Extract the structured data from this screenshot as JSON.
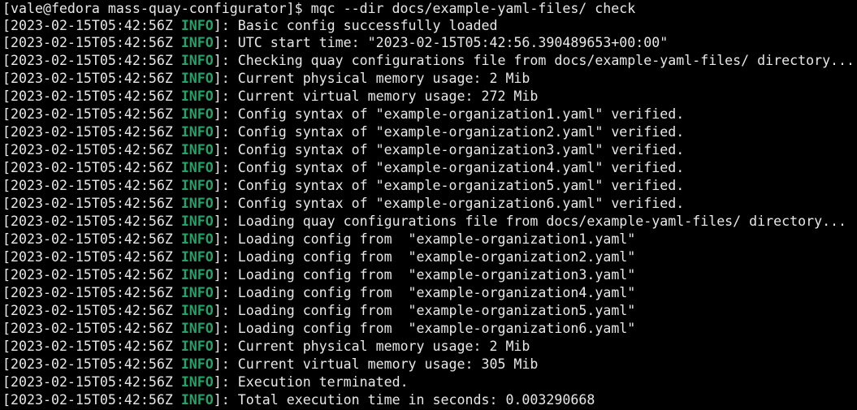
{
  "terminal": {
    "prompt_line": "[vale@fedora mass-quay-configurator]$ mqc --dir docs/example-yaml-files/ check",
    "colors": {
      "background": "#000000",
      "foreground": "#e8e8e8",
      "info_level": "#26a269"
    },
    "log_lines": [
      {
        "timestamp": "2023-02-15T05:42:56Z",
        "level": "INFO",
        "message": "Basic config successfully loaded"
      },
      {
        "timestamp": "2023-02-15T05:42:56Z",
        "level": "INFO",
        "message": "UTC start time: \"2023-02-15T05:42:56.390489653+00:00\""
      },
      {
        "timestamp": "2023-02-15T05:42:56Z",
        "level": "INFO",
        "message": "Checking quay configurations file from docs/example-yaml-files/ directory..."
      },
      {
        "timestamp": "2023-02-15T05:42:56Z",
        "level": "INFO",
        "message": "Current physical memory usage: 2 Mib"
      },
      {
        "timestamp": "2023-02-15T05:42:56Z",
        "level": "INFO",
        "message": "Current virtual memory usage: 272 Mib"
      },
      {
        "timestamp": "2023-02-15T05:42:56Z",
        "level": "INFO",
        "message": "Config syntax of \"example-organization1.yaml\" verified."
      },
      {
        "timestamp": "2023-02-15T05:42:56Z",
        "level": "INFO",
        "message": "Config syntax of \"example-organization2.yaml\" verified."
      },
      {
        "timestamp": "2023-02-15T05:42:56Z",
        "level": "INFO",
        "message": "Config syntax of \"example-organization3.yaml\" verified."
      },
      {
        "timestamp": "2023-02-15T05:42:56Z",
        "level": "INFO",
        "message": "Config syntax of \"example-organization4.yaml\" verified."
      },
      {
        "timestamp": "2023-02-15T05:42:56Z",
        "level": "INFO",
        "message": "Config syntax of \"example-organization5.yaml\" verified."
      },
      {
        "timestamp": "2023-02-15T05:42:56Z",
        "level": "INFO",
        "message": "Config syntax of \"example-organization6.yaml\" verified."
      },
      {
        "timestamp": "2023-02-15T05:42:56Z",
        "level": "INFO",
        "message": "Loading quay configurations file from docs/example-yaml-files/ directory..."
      },
      {
        "timestamp": "2023-02-15T05:42:56Z",
        "level": "INFO",
        "message": "Loading config from  \"example-organization1.yaml\""
      },
      {
        "timestamp": "2023-02-15T05:42:56Z",
        "level": "INFO",
        "message": "Loading config from  \"example-organization2.yaml\""
      },
      {
        "timestamp": "2023-02-15T05:42:56Z",
        "level": "INFO",
        "message": "Loading config from  \"example-organization3.yaml\""
      },
      {
        "timestamp": "2023-02-15T05:42:56Z",
        "level": "INFO",
        "message": "Loading config from  \"example-organization4.yaml\""
      },
      {
        "timestamp": "2023-02-15T05:42:56Z",
        "level": "INFO",
        "message": "Loading config from  \"example-organization5.yaml\""
      },
      {
        "timestamp": "2023-02-15T05:42:56Z",
        "level": "INFO",
        "message": "Loading config from  \"example-organization6.yaml\""
      },
      {
        "timestamp": "2023-02-15T05:42:56Z",
        "level": "INFO",
        "message": "Current physical memory usage: 2 Mib"
      },
      {
        "timestamp": "2023-02-15T05:42:56Z",
        "level": "INFO",
        "message": "Current virtual memory usage: 305 Mib"
      },
      {
        "timestamp": "2023-02-15T05:42:56Z",
        "level": "INFO",
        "message": "Execution terminated."
      },
      {
        "timestamp": "2023-02-15T05:42:56Z",
        "level": "INFO",
        "message": "Total execution time in seconds: 0.003290668"
      }
    ]
  }
}
